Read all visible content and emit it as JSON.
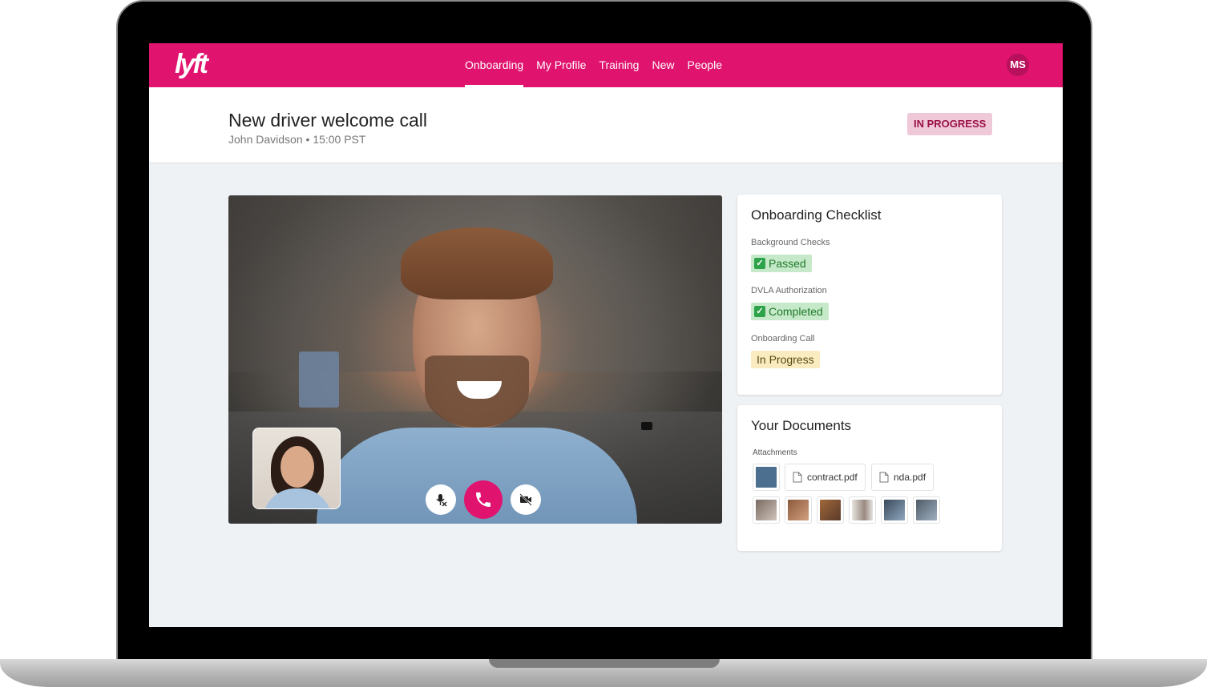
{
  "app": {
    "logo_text": "lyft",
    "accent_color": "#e0136f"
  },
  "nav": {
    "items": [
      {
        "label": "Onboarding",
        "active": true
      },
      {
        "label": "My Profile",
        "active": false
      },
      {
        "label": "Training",
        "active": false
      },
      {
        "label": "New",
        "active": false
      },
      {
        "label": "People",
        "active": false
      }
    ],
    "avatar_initials": "MS"
  },
  "header": {
    "title": "New driver welcome call",
    "subtitle": "John Davidson • 15:00 PST",
    "status": "IN PROGRESS"
  },
  "call": {
    "controls": [
      {
        "icon": "mic-muted-icon"
      },
      {
        "icon": "phone-icon"
      },
      {
        "icon": "video-off-icon"
      }
    ]
  },
  "checklist": {
    "title": "Onboarding Checklist",
    "items": [
      {
        "label": "Background Checks",
        "status": "Passed",
        "color": "green"
      },
      {
        "label": "DVLA Authorization",
        "status": "Completed",
        "color": "green"
      },
      {
        "label": "Onboarding Call",
        "status": "In Progress",
        "color": "yellow"
      }
    ]
  },
  "documents": {
    "title": "Your Documents",
    "attachments_label": "Attachments",
    "files": [
      {
        "name": "contract.pdf",
        "icon": "file-icon"
      },
      {
        "name": "nda.pdf",
        "icon": "file-icon"
      }
    ],
    "thumbnail_colors": [
      "#4d6f8f",
      "#7a6a62",
      "#8b5a3e",
      "#a0683a",
      "#cfcac4",
      "#3a4a5c",
      "#4e5a66"
    ]
  }
}
